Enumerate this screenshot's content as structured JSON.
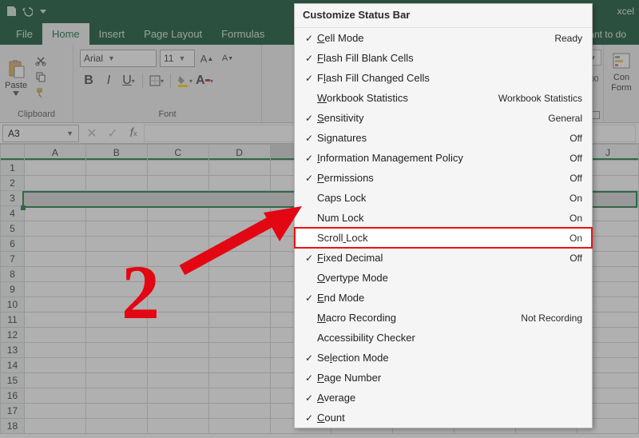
{
  "titlebar": {
    "app_suffix": "xcel"
  },
  "tabs": {
    "file": "File",
    "home": "Home",
    "insert": "Insert",
    "pagelayout": "Page Layout",
    "formulas": "Formulas",
    "tellme": "want to do"
  },
  "ribbon": {
    "clipboard": {
      "paste": "Paste",
      "label": "Clipboard"
    },
    "font": {
      "name": "Arial",
      "size": "11",
      "label": "Font"
    },
    "right": {
      "cond": "Con",
      "form": "Form",
      "dec": ".00"
    }
  },
  "namebox": "A3",
  "columns": [
    "A",
    "B",
    "C",
    "D",
    "",
    "",
    "",
    "",
    "",
    "J"
  ],
  "rows": [
    "1",
    "2",
    "3",
    "4",
    "5",
    "6",
    "7",
    "8",
    "9",
    "10",
    "11",
    "12",
    "13",
    "14",
    "15",
    "16",
    "17",
    "18"
  ],
  "menu": {
    "title": "Customize Status Bar",
    "items": [
      {
        "checked": true,
        "label": "Cell Mode",
        "u": 0,
        "value": "Ready"
      },
      {
        "checked": true,
        "label": "Flash Fill Blank Cells",
        "u": 0
      },
      {
        "checked": true,
        "label": "Flash Fill Changed Cells",
        "u": 1
      },
      {
        "checked": false,
        "label": "Workbook Statistics",
        "u": 0,
        "value": "Workbook Statistics"
      },
      {
        "checked": true,
        "label": "Sensitivity",
        "u": 0,
        "value": "General"
      },
      {
        "checked": true,
        "label": "Signatures",
        "u": 2,
        "value": "Off"
      },
      {
        "checked": true,
        "label": "Information Management Policy",
        "u": 0,
        "value": "Off"
      },
      {
        "checked": true,
        "label": "Permissions",
        "u": 0,
        "value": "Off"
      },
      {
        "checked": false,
        "label": "Caps Lock",
        "u": -1,
        "value": "On"
      },
      {
        "checked": false,
        "label": "Num Lock",
        "u": -1,
        "value": "On"
      },
      {
        "checked": false,
        "label": "Scroll Lock",
        "u": 6,
        "value": "On",
        "highlight": true
      },
      {
        "checked": true,
        "label": "Fixed Decimal",
        "u": 0,
        "value": "Off"
      },
      {
        "checked": false,
        "label": "Overtype Mode",
        "u": 0
      },
      {
        "checked": true,
        "label": "End Mode",
        "u": 0
      },
      {
        "checked": false,
        "label": "Macro Recording",
        "u": 0,
        "value": "Not Recording"
      },
      {
        "checked": false,
        "label": "Accessibility Checker",
        "u": -1
      },
      {
        "checked": true,
        "label": "Selection Mode",
        "u": 2
      },
      {
        "checked": true,
        "label": "Page Number",
        "u": 0
      },
      {
        "checked": true,
        "label": "Average",
        "u": 0
      },
      {
        "checked": true,
        "label": "Count",
        "u": 0
      }
    ]
  },
  "annotation": {
    "number": "2"
  }
}
